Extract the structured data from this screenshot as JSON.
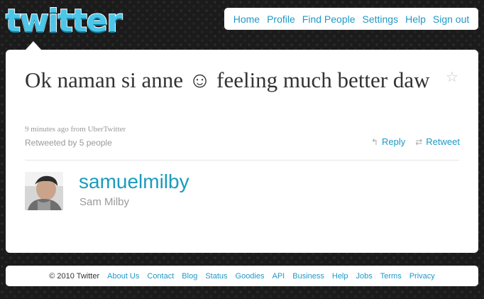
{
  "brand": {
    "logo_text": "twitter"
  },
  "nav": {
    "items": [
      "Home",
      "Profile",
      "Find People",
      "Settings",
      "Help",
      "Sign out"
    ]
  },
  "tweet": {
    "text": "Ok naman si anne ☺ feeling much better daw",
    "time": "9 minutes ago",
    "from_label": "from",
    "source": "UberTwitter",
    "retweeted_by": "Retweeted by 5 people",
    "reply_label": "Reply",
    "retweet_label": "Retweet"
  },
  "user": {
    "username": "samuelmilby",
    "full_name": "Sam Milby"
  },
  "footer": {
    "copyright": "© 2010 Twitter",
    "links": [
      "About Us",
      "Contact",
      "Blog",
      "Status",
      "Goodies",
      "API",
      "Business",
      "Help",
      "Jobs",
      "Terms",
      "Privacy"
    ]
  },
  "colors": {
    "link": "#1f98c7",
    "username": "#1b9bbd",
    "logo": "#4cc6e8",
    "background": "#1b1b1b"
  },
  "icons": {
    "favorite": "star-icon",
    "reply": "reply-arrow-icon",
    "retweet": "retweet-icon"
  }
}
